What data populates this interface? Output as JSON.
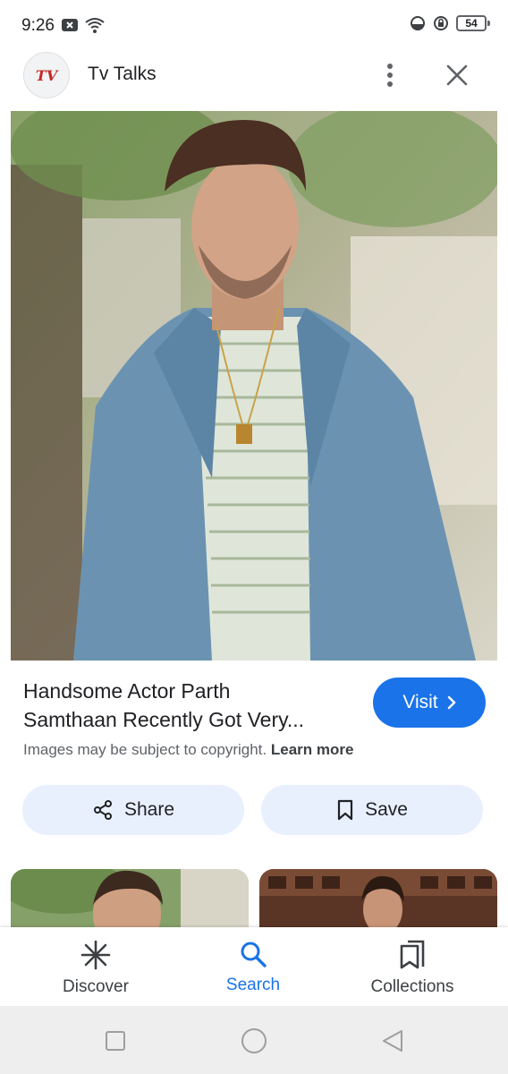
{
  "status_bar": {
    "time": "9:26",
    "battery": "54",
    "icons": [
      "notification-x-icon",
      "wifi-icon",
      "data-saver-icon",
      "lock-rotate-icon",
      "battery-icon"
    ]
  },
  "header": {
    "logo_text": "TV",
    "source_name": "Tv Talks"
  },
  "result": {
    "title_line1": "Handsome Actor Parth",
    "title_line2": "Samthaan Recently Got Very...",
    "visit_label": "Visit",
    "copyright_text": "Images may be subject to copyright.",
    "learn_more": "Learn more"
  },
  "actions": {
    "share_label": "Share",
    "save_label": "Save"
  },
  "bottom_nav": {
    "items": [
      {
        "label": "Discover",
        "icon": "asterisk-icon"
      },
      {
        "label": "Search",
        "icon": "search-icon",
        "active": true
      },
      {
        "label": "Collections",
        "icon": "collections-icon"
      }
    ]
  },
  "colors": {
    "accent": "#1a73e8",
    "button_bg": "#e8f0fe",
    "text": "#202124",
    "muted": "#5f6368"
  }
}
